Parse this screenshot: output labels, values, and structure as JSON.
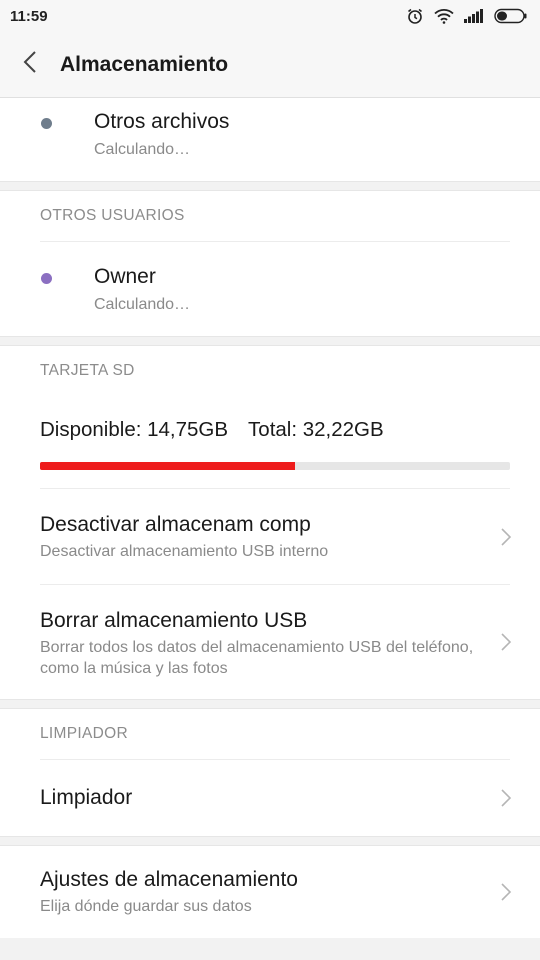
{
  "status": {
    "time": "11:59"
  },
  "appbar": {
    "title": "Almacenamiento"
  },
  "top_item": {
    "title": "Otros archivos",
    "subtitle": "Calculando…",
    "dot_color": "#6f7d8c"
  },
  "other_users": {
    "header": "OTROS USUARIOS",
    "item": {
      "title": "Owner",
      "subtitle": "Calculando…",
      "dot_color": "#8b6fc1"
    }
  },
  "sd_card": {
    "header": "TARJETA SD",
    "available": "Disponible: 14,75GB",
    "total": "Total: 32,22GB",
    "used_fraction": 0.542,
    "bar_color": "#ee1c1c",
    "items": [
      {
        "title": "Desactivar almacenam comp",
        "subtitle": "Desactivar almacenamiento USB interno"
      },
      {
        "title": "Borrar almacenamiento USB",
        "subtitle": "Borrar todos los datos del almacenamiento USB del teléfono, como la música y las fotos"
      }
    ]
  },
  "cleaner": {
    "header": "LIMPIADOR",
    "item": {
      "title": "Limpiador"
    }
  },
  "settings": {
    "title": "Ajustes de almacenamiento",
    "subtitle": "Elija dónde guardar sus datos"
  }
}
